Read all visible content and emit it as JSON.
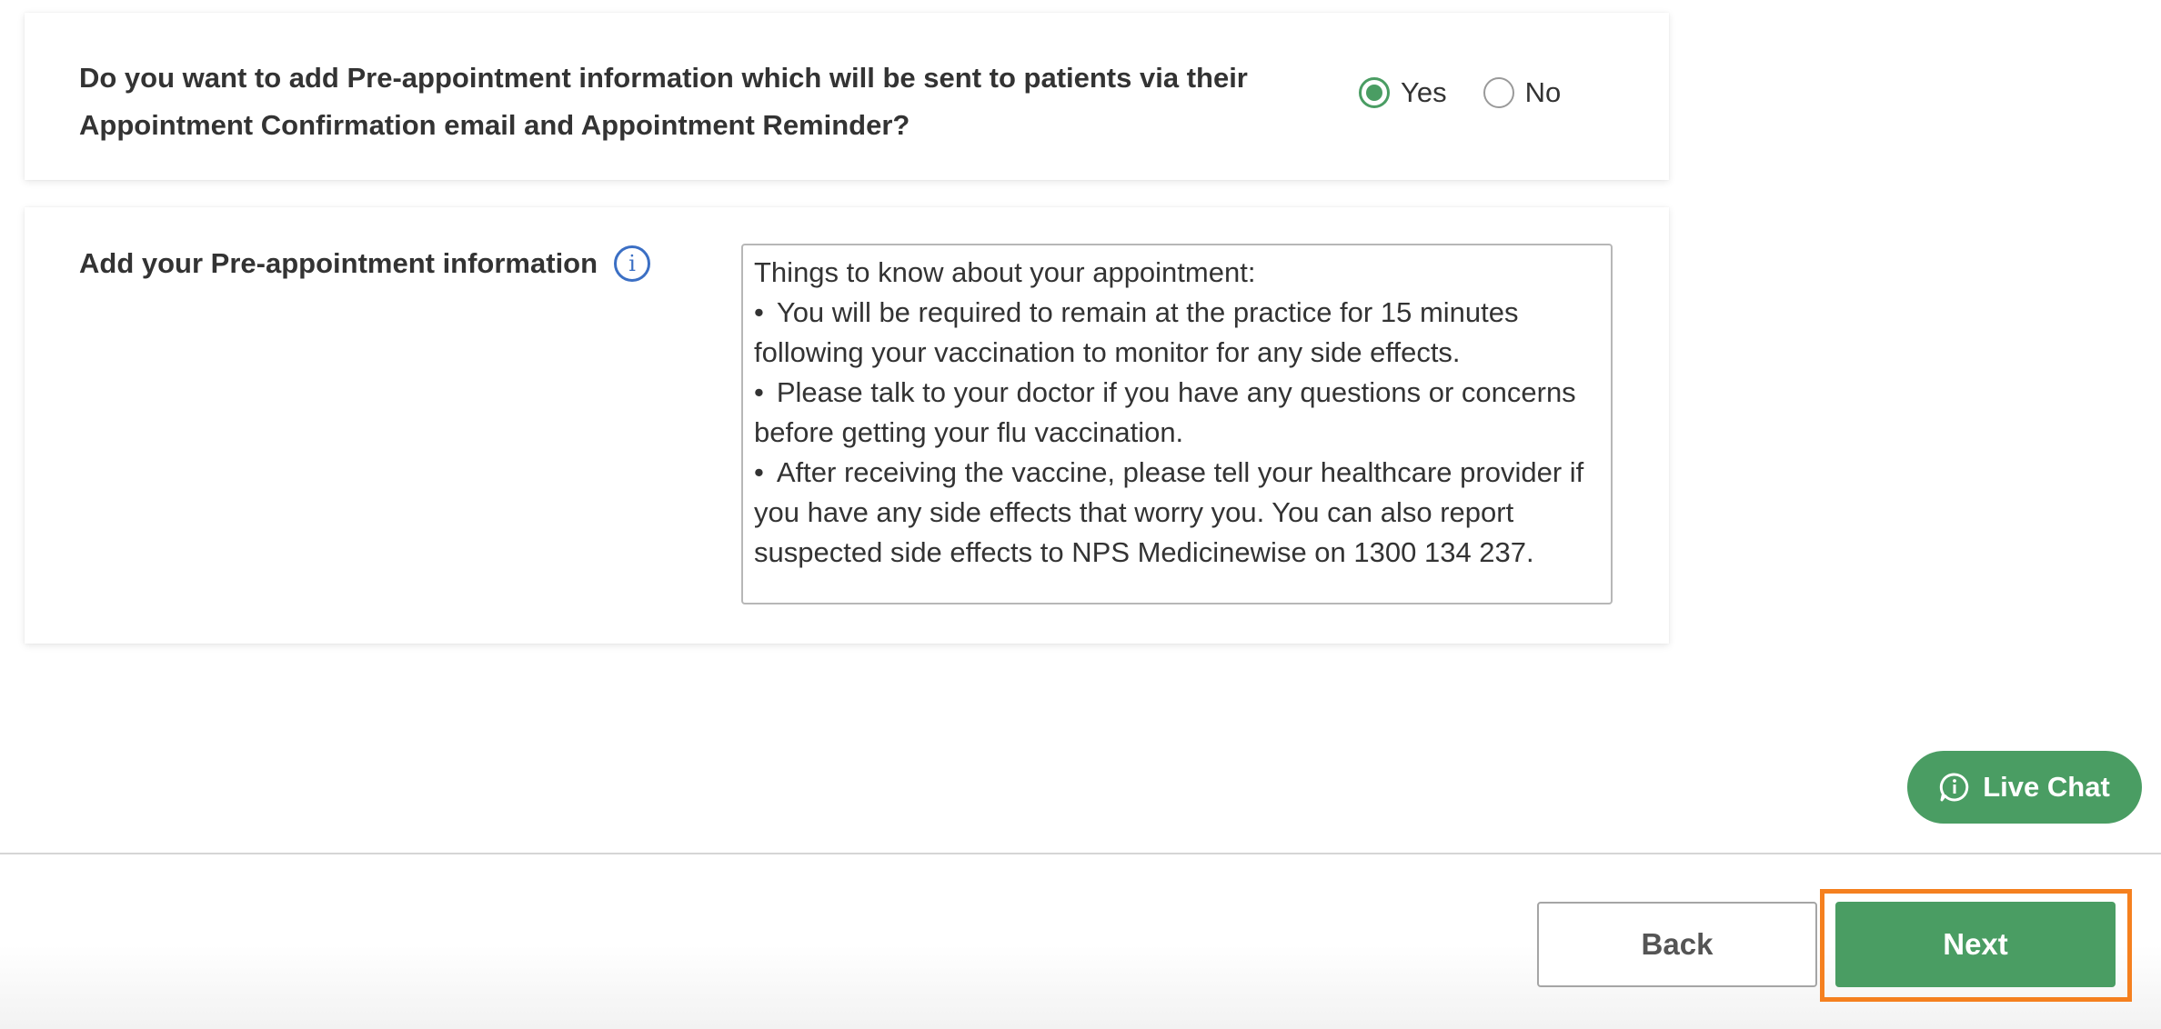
{
  "question_card": {
    "question": "Do you want to add Pre-appointment information which will be sent to patients via their Appointment Confirmation email and Appointment Reminder?",
    "options": [
      {
        "label": "Yes",
        "selected": true
      },
      {
        "label": "No",
        "selected": false
      }
    ]
  },
  "info_card": {
    "label": "Add your Pre-appointment information",
    "info_icon": "info-icon",
    "textarea": {
      "heading": "Things to know about your appointment:",
      "bullet_symbol": "•",
      "bullets": [
        "You will be required to remain at the practice for 15 minutes following your vaccination to monitor for any side effects.",
        "Please talk to your doctor if you have any questions or concerns before getting your flu vaccination.",
        "After receiving the vaccine, please tell your healthcare provider if you have any side effects that worry you. You can also report suspected side effects to NPS Medicinewise on 1300 134 237."
      ]
    }
  },
  "live_chat": {
    "label": "Live Chat",
    "icon": "chat-info-icon"
  },
  "footer": {
    "back_label": "Back",
    "next_label": "Next"
  },
  "colors": {
    "accent_green": "#4a9d63",
    "info_blue": "#3b6fc4",
    "highlight_orange": "#f5801f"
  }
}
